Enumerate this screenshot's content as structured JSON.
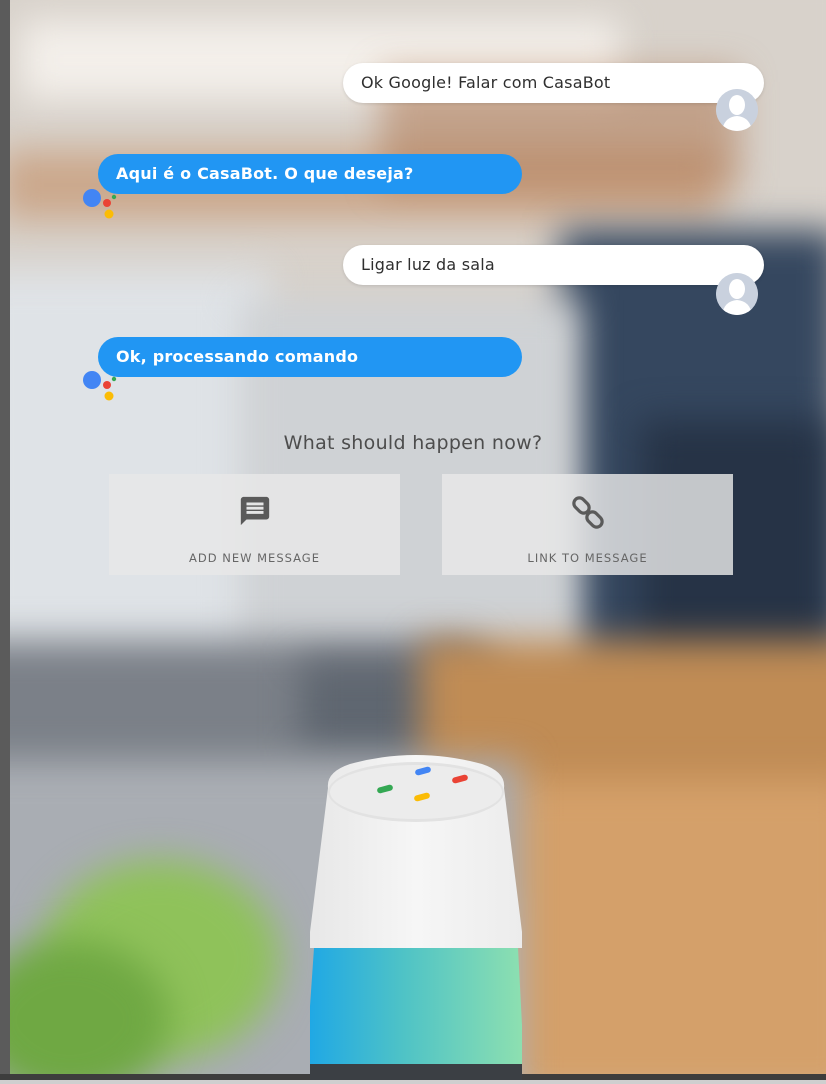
{
  "conversation": {
    "messages": [
      {
        "sender": "user",
        "text": "Ok Google! Falar com CasaBot"
      },
      {
        "sender": "bot",
        "text": "Aqui é o CasaBot. O que deseja?"
      },
      {
        "sender": "user",
        "text": "Ligar luz da sala"
      },
      {
        "sender": "bot",
        "text": "Ok, processando comando"
      }
    ]
  },
  "prompt": {
    "text": "What should happen now?"
  },
  "actions": [
    {
      "label": "ADD NEW MESSAGE",
      "icon": "message-icon"
    },
    {
      "label": "LINK TO MESSAGE",
      "icon": "link-icon"
    }
  ],
  "colors": {
    "bot_bubble": "#2196f3",
    "user_bubble": "#ffffff",
    "assistant_blue": "#4285f4",
    "assistant_red": "#ea4335",
    "assistant_yellow": "#fbbc05",
    "assistant_green": "#34a853"
  },
  "speaker": {
    "name": "google-home-speaker"
  }
}
